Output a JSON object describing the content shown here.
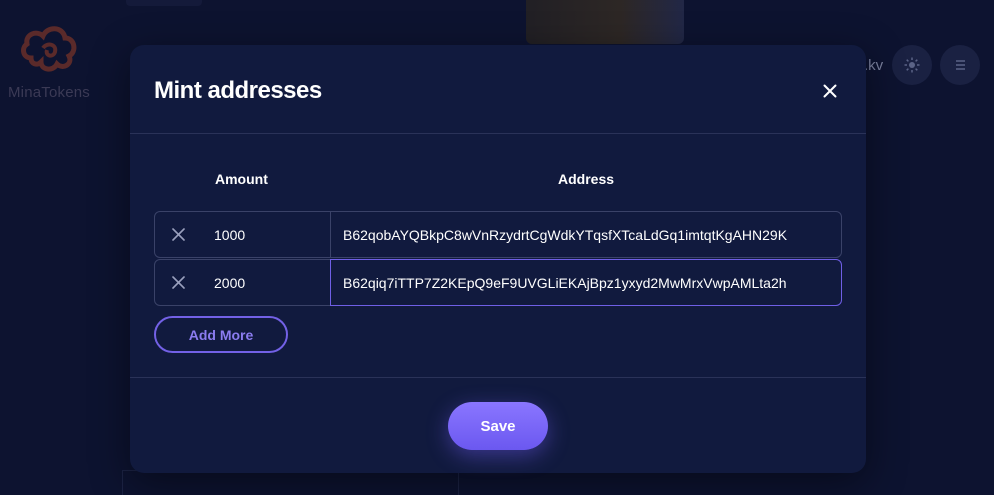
{
  "app": {
    "logo_text": "MinaTokens",
    "account_partial": ".kv"
  },
  "modal": {
    "title": "Mint addresses",
    "columns": {
      "amount": "Amount",
      "address": "Address"
    },
    "rows": [
      {
        "amount": "1000",
        "address": "B62qobAYQBkpC8wVnRzydrtCgWdkYTqsfXTcaLdGq1imtqtKgAHN29K"
      },
      {
        "amount": "2000",
        "address": "B62qiq7iTTP7Z2KEpQ9eF9UVGLiEKAjBpz1yxyd2MwMrxVwpAMLta2h"
      }
    ],
    "add_more_label": "Add More",
    "save_label": "Save"
  },
  "colors": {
    "background": "#0d1330",
    "modal": "#111a3e",
    "accent": "#7361e6"
  },
  "icons": {
    "close": "close-icon",
    "remove_row": "x-icon",
    "theme": "sun-icon",
    "menu": "menu-icon"
  }
}
